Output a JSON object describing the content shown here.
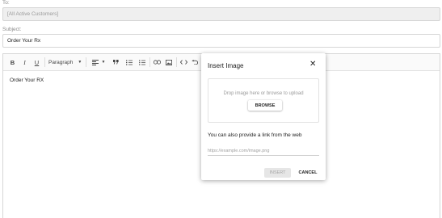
{
  "to": {
    "label": "To:",
    "value": "[All Active Customers]"
  },
  "subject": {
    "label": "Subject:",
    "value": "Order Your Rx"
  },
  "toolbar": {
    "bold": "B",
    "italic": "I",
    "underline": "U",
    "paragraph": "Paragraph",
    "dropdown_arrow": "▼",
    "icons": [
      "bold-icon",
      "italic-icon",
      "underline-icon",
      "align-icon",
      "quote-icon",
      "numbered-list-icon",
      "bullet-list-icon",
      "link-icon",
      "image-icon",
      "code-icon",
      "undo-icon"
    ]
  },
  "editor": {
    "body_text": "Order Your RX"
  },
  "modal": {
    "title": "Insert Image",
    "close": "✕",
    "drop_text": "Drop image here or browse to upload",
    "browse_label": "BROWSE",
    "link_text": "You can also provide a link from the web",
    "url_placeholder": "https://example.com/image.png",
    "insert_label": "INSERT",
    "cancel_label": "CANCEL"
  }
}
